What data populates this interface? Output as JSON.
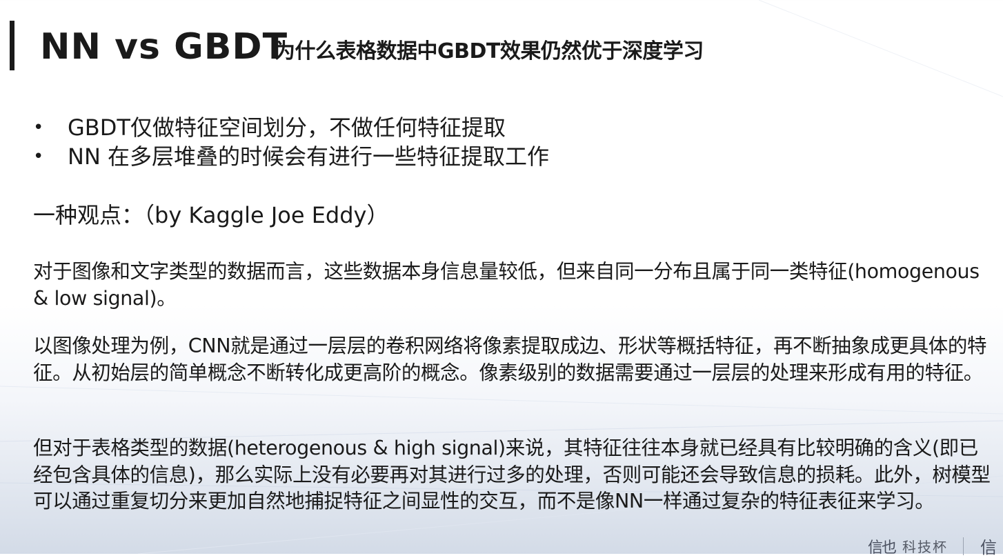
{
  "slide": {
    "title_main": "NN vs GBDT",
    "title_sub": "为什么表格数据中GBDT效果仍然优于深度学习",
    "bullet_symbol": "•",
    "bullets": [
      "GBDT仅做特征空间划分，不做任何特征提取",
      "NN 在多层堆叠的时候会有进行一些特征提取工作"
    ],
    "viewpoint": "一种观点：（by Kaggle Joe Eddy）",
    "paragraphs": [
      "对于图像和文字类型的数据而言，这些数据本身信息量较低，但来自同一分布且属于同一类特征(homogenous & low signal)。",
      "以图像处理为例，CNN就是通过一层层的卷积网络将像素提取成边、形状等概括特征，再不断抽象成更具体的特征。从初始层的简单概念不断转化成更高阶的概念。像素级别的数据需要通过一层层的处理来形成有用的特征。",
      "但对于表格类型的数据(heterogenous & high signal)来说，其特征往往本身就已经具有比较明确的含义(即已经包含具体的信息)，那么实际上没有必要再对其进行过多的处理，否则可能还会导致信息的损耗。此外，树模型可以通过重复切分来更加自然地捕捉特征之间显性的交互，而不是像NN一样通过复杂的特征表征来学习。"
    ]
  },
  "footer": {
    "logo_mark": "信也",
    "logo_name": "科技杯",
    "logo_mark_2": "信"
  },
  "colors": {
    "text": "#1a1a1a",
    "accent_bar": "#1a1a1a",
    "footer_text": "#555a66"
  }
}
